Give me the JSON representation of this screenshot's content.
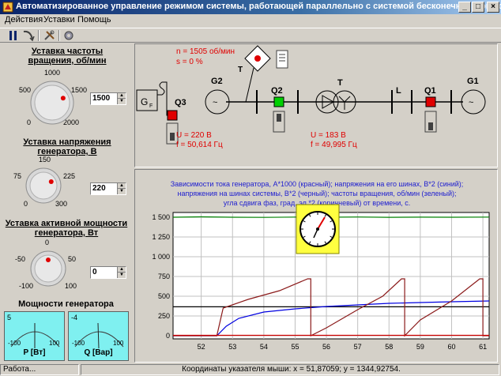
{
  "window": {
    "title": "Автоматизированное управление режимом системы, работающей параллельно с системой бесконечной мощности",
    "min": "_",
    "max": "□",
    "close": "×"
  },
  "menu": [
    "Действия",
    "Уставки",
    "Помощь"
  ],
  "left": {
    "speed": {
      "label": "Уставка частоты вращения, об/мин",
      "ticks": [
        "1000",
        "500",
        "1500",
        "0",
        "2000"
      ],
      "value": "1500",
      "level_fraction": 0.75
    },
    "voltage": {
      "label": "Уставка напряжения генератора, В",
      "ticks": [
        "150",
        "75",
        "225",
        "0",
        "300"
      ],
      "value": "220",
      "level_fraction": 0.733
    },
    "power": {
      "label": "Уставка активной мощности генератора, Вт",
      "ticks": [
        "0",
        "-50",
        "50",
        "-100",
        "100"
      ],
      "value": "0",
      "level_fraction": 0.5
    },
    "meters_title": "Мощности генератора",
    "meter_p": {
      "scale": [
        "5",
        "-100",
        "100"
      ],
      "label": "P [Вт]",
      "value": 5
    },
    "meter_q": {
      "scale": [
        "-4",
        "-100",
        "100"
      ],
      "label": "Q [Вар]",
      "value": -4
    }
  },
  "schematic": {
    "speed_text": "n = 1505 об/мин",
    "slip_text": "s = 0 %",
    "labels": {
      "gf": "G",
      "gf_sub": "F",
      "q3": "Q3",
      "g2": "G2",
      "q2": "Q2",
      "t1": "T",
      "t2": "T",
      "l": "L",
      "q1": "Q1",
      "g1": "G1"
    },
    "left_meas": {
      "u": "U = 220 В",
      "f": "f = 50,614 Гц"
    },
    "right_meas": {
      "u": "U = 183 В",
      "f": "f = 49,995 Гц"
    }
  },
  "chart": {
    "caption": [
      "Зависимости тока генератора, А*1000 (красный); напряжения на его шинах, В*2 (синий);",
      "напряжения на шинах системы, В*2 (черный); частоты вращения, об/мин (зеленый);",
      "угла сдвига фаз, град. эл.*2 (коричневый) от времени, с."
    ],
    "accent": "#ffff40"
  },
  "chart_data": {
    "type": "line",
    "title": "",
    "xlim": [
      51.1,
      61.2
    ],
    "ylim": [
      -40,
      1560
    ],
    "x_ticks": [
      52,
      53,
      54,
      55,
      56,
      57,
      58,
      59,
      60,
      61
    ],
    "y_ticks": [
      0,
      250,
      500,
      750,
      1000,
      1250,
      1500
    ],
    "y_tick_labels": [
      "0",
      "250",
      "500",
      "750",
      "1 000",
      "1 250",
      "1 500"
    ],
    "series": [
      {
        "color": "#008000",
        "x": [
          51.1,
          52,
          53,
          54,
          55,
          56,
          57,
          58,
          59,
          60,
          61.2
        ],
        "y": [
          1500,
          1505,
          1500,
          1498,
          1502,
          1500,
          1503,
          1499,
          1501,
          1500,
          1502
        ]
      },
      {
        "color": "#000000",
        "x": [
          51.1,
          61.2
        ],
        "y": [
          366,
          366
        ]
      },
      {
        "color": "#0000e0",
        "x": [
          51.1,
          52.5,
          52.8,
          53.2,
          54,
          55,
          56,
          57,
          58,
          59,
          60,
          61.2
        ],
        "y": [
          0,
          0,
          120,
          220,
          300,
          340,
          370,
          390,
          410,
          420,
          430,
          440
        ]
      },
      {
        "color": "#8b1a1a",
        "x": [
          51.1,
          52.5,
          52.7,
          53.5,
          54.5,
          55.4,
          55.5,
          55.5,
          56,
          57,
          57.8,
          58.4,
          58.5,
          58.5,
          59,
          60,
          60.9,
          61.0,
          61.0,
          61.2
        ],
        "y": [
          0,
          0,
          350,
          460,
          570,
          720,
          720,
          0,
          100,
          330,
          500,
          720,
          720,
          0,
          200,
          440,
          720,
          720,
          0,
          0
        ]
      },
      {
        "color": "#cc0000",
        "x": [
          51.1,
          61.2
        ],
        "y": [
          5,
          5
        ]
      }
    ]
  },
  "status": {
    "left": "Работа...",
    "right": "Координаты указателя мыши: x = 51,87059;  y = 1344,92754."
  }
}
